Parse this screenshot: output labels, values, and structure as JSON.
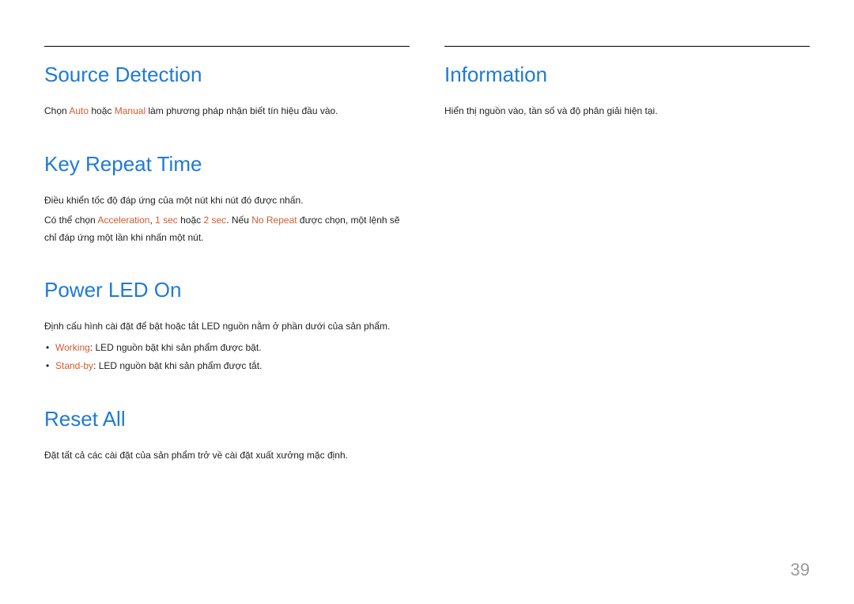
{
  "left": {
    "sections": [
      {
        "heading": "Source Detection",
        "paragraphs": [
          {
            "parts": [
              {
                "t": "Chọn "
              },
              {
                "t": "Auto",
                "hl": true
              },
              {
                "t": " hoặc "
              },
              {
                "t": "Manual",
                "hl": true
              },
              {
                "t": " làm phương pháp nhận biết tín hiệu đầu vào."
              }
            ]
          }
        ]
      },
      {
        "heading": "Key Repeat Time",
        "paragraphs": [
          {
            "parts": [
              {
                "t": "Điều khiển tốc độ đáp ứng của một nút khi nút đó được nhấn."
              }
            ]
          },
          {
            "parts": [
              {
                "t": "Có thể chọn "
              },
              {
                "t": "Acceleration",
                "hl": true
              },
              {
                "t": ", "
              },
              {
                "t": "1 sec",
                "hl": true
              },
              {
                "t": " hoặc "
              },
              {
                "t": "2 sec",
                "hl": true
              },
              {
                "t": ". Nếu "
              },
              {
                "t": "No Repeat",
                "hl": true
              },
              {
                "t": " được chọn, một lệnh sẽ chỉ đáp ứng một lần khi nhấn một nút."
              }
            ]
          }
        ]
      },
      {
        "heading": "Power LED On",
        "paragraphs": [
          {
            "parts": [
              {
                "t": "Định cấu hình cài đặt để bật hoặc tắt LED nguồn nằm ở phần dưới của sản phẩm."
              }
            ]
          }
        ],
        "bullets": [
          {
            "parts": [
              {
                "t": "Working",
                "hl": true
              },
              {
                "t": ": LED nguồn bật khi sản phẩm được bật."
              }
            ]
          },
          {
            "parts": [
              {
                "t": "Stand-by",
                "hl": true
              },
              {
                "t": ": LED nguồn bật khi sản phẩm được tắt."
              }
            ]
          }
        ]
      },
      {
        "heading": "Reset All",
        "paragraphs": [
          {
            "parts": [
              {
                "t": "Đặt tất cả các cài đặt của sản phẩm trở về cài đặt xuất xưởng mặc định."
              }
            ]
          }
        ]
      }
    ]
  },
  "right": {
    "sections": [
      {
        "heading": "Information",
        "paragraphs": [
          {
            "parts": [
              {
                "t": "Hiển thị nguồn vào, tần số và độ phân giải hiện tại."
              }
            ]
          }
        ]
      }
    ]
  },
  "page_number": "39"
}
